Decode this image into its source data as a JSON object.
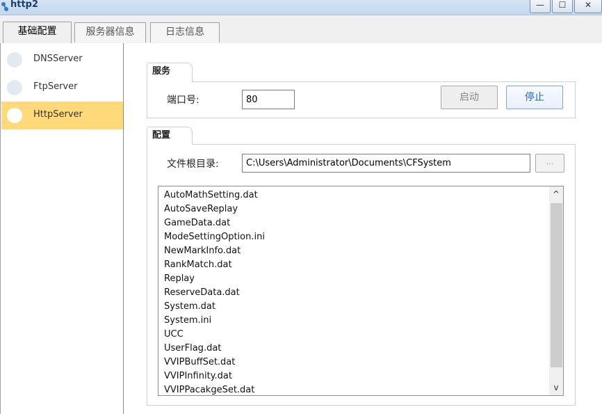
{
  "window": {
    "title": "http2",
    "min_glyph": "—",
    "max_glyph": "☐",
    "close_glyph": "✕"
  },
  "tabs": [
    {
      "label": "基础配置",
      "active": true
    },
    {
      "label": "服务器信息",
      "active": false
    },
    {
      "label": "日志信息",
      "active": false
    }
  ],
  "nav": {
    "items": [
      {
        "label": "DNSServer",
        "selected": false
      },
      {
        "label": "FtpServer",
        "selected": false
      },
      {
        "label": "HttpServer",
        "selected": true
      }
    ],
    "selected_color": "#ffd97a"
  },
  "service": {
    "group_title": "服务",
    "port_label": "端口号:",
    "port_value": "80",
    "start_label": "启动",
    "stop_label": "停止"
  },
  "config": {
    "group_title": "配置",
    "root_label": "文件根目录:",
    "root_value": "C:\\Users\\Administrator\\Documents\\CFSystem",
    "browse_label": "...",
    "files": [
      "AutoMathSetting.dat",
      "AutoSaveReplay",
      "GameData.dat",
      "ModeSettingOption.ini",
      "NewMarkInfo.dat",
      "RankMatch.dat",
      "Replay",
      "ReserveData.dat",
      "System.dat",
      "System.ini",
      "UCC",
      "UserFlag.dat",
      "VVIPBuffSet.dat",
      "VVIPInfinity.dat",
      "VVIPPacakgeSet.dat"
    ],
    "scroll_up_glyph": "^",
    "scroll_down_glyph": "v"
  },
  "icons": {
    "app": "network-icon",
    "nav_item": "circle-icon"
  }
}
